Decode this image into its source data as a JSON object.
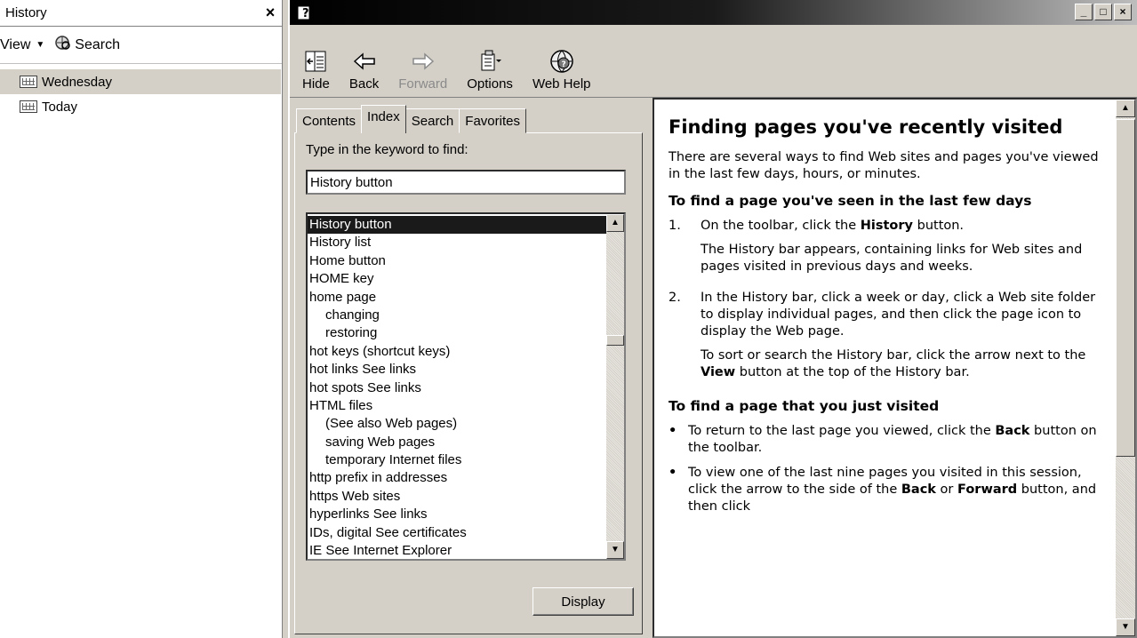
{
  "history_pane": {
    "title": "History",
    "close": "×",
    "view_label": "View",
    "search_label": "Search",
    "items": [
      {
        "label": "Wednesday",
        "selected": true
      },
      {
        "label": "Today",
        "selected": false
      }
    ]
  },
  "window": {
    "min": "_",
    "max": "□",
    "close": "×"
  },
  "toolbar": {
    "hide": "Hide",
    "back": "Back",
    "forward": "Forward",
    "options": "Options",
    "web_help": "Web Help"
  },
  "tabs": [
    "Contents",
    "Index",
    "Search",
    "Favorites"
  ],
  "index": {
    "prompt": "Type in the keyword to find:",
    "input_value": "History button",
    "keywords": [
      {
        "text": "History button",
        "sub": false,
        "selected": true
      },
      {
        "text": "History list",
        "sub": false
      },
      {
        "text": "Home button",
        "sub": false
      },
      {
        "text": "HOME key",
        "sub": false
      },
      {
        "text": "home page",
        "sub": false
      },
      {
        "text": "changing",
        "sub": true
      },
      {
        "text": "restoring",
        "sub": true
      },
      {
        "text": "hot keys (shortcut keys)",
        "sub": false
      },
      {
        "text": "hot links See links",
        "sub": false
      },
      {
        "text": "hot spots See links",
        "sub": false
      },
      {
        "text": "HTML files",
        "sub": false
      },
      {
        "text": "(See also Web pages)",
        "sub": true
      },
      {
        "text": "saving Web pages",
        "sub": true
      },
      {
        "text": "temporary Internet files",
        "sub": true
      },
      {
        "text": "http prefix in addresses",
        "sub": false
      },
      {
        "text": "https Web sites",
        "sub": false
      },
      {
        "text": "hyperlinks See links",
        "sub": false
      },
      {
        "text": "IDs, digital See certificates",
        "sub": false
      },
      {
        "text": "IE See Internet Explorer",
        "sub": false
      }
    ],
    "display_button": "Display"
  },
  "topic": {
    "title": "Finding pages you've recently visited",
    "intro": "There are several ways to find Web sites and pages you've viewed in the last few days, hours, or minutes.",
    "h2_a": "To find a page you've seen in the last few days",
    "step1_num": "1.",
    "step1_pre": "On the toolbar, click the ",
    "step1_bold": "History",
    "step1_post": " button.",
    "step1_note": "The History bar appears, containing links for Web sites and pages visited in previous days and weeks.",
    "step2_num": "2.",
    "step2_text": "In the History bar, click a week or day, click a Web site folder to display individual pages, and then click the page icon to display the Web page.",
    "step2_note_pre": "To sort or search the History bar, click the arrow next to the ",
    "step2_note_bold": "View",
    "step2_note_post": " button at the top of the History bar.",
    "h2_b": "To find a page that you just visited",
    "b1_pre": "To return to the last page you viewed, click the ",
    "b1_bold": "Back",
    "b1_post": " button on the toolbar.",
    "b2_pre": "To view one of the last nine pages you visited in this session, click the arrow to the side of the ",
    "b2_bold1": "Back",
    "b2_mid": " or ",
    "b2_bold2": "Forward",
    "b2_post": " button, and then click"
  }
}
